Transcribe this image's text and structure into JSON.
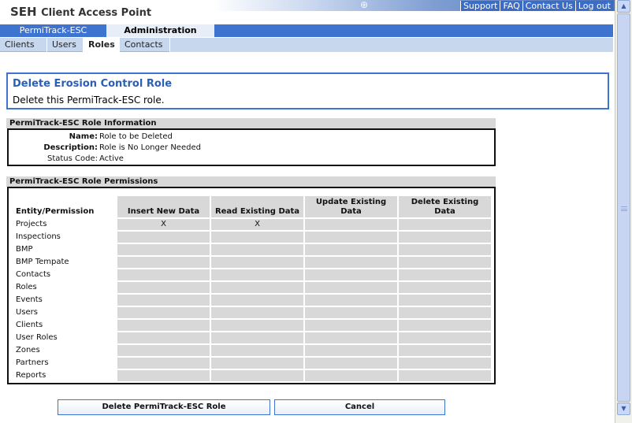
{
  "header": {
    "logo_brand": "SEH",
    "logo_title": "Client Access Point",
    "links": [
      "Support",
      "FAQ",
      "Contact Us",
      "Log out"
    ]
  },
  "main_tabs": [
    "PermiTrack-ESC",
    "Administration"
  ],
  "sub_tabs": [
    "Clients",
    "Users",
    "Roles",
    "Contacts"
  ],
  "page": {
    "title": "Delete Erosion Control Role",
    "subtitle": "Delete this PermiTrack-ESC role."
  },
  "info": {
    "header": "PermiTrack-ESC Role Information",
    "name_label": "Name:",
    "name_value": "Role to be Deleted",
    "description_label": "Description:",
    "description_value": "Role is No Longer Needed",
    "status_label": "Status Code:",
    "status_value": "Active"
  },
  "permissions": {
    "header": "PermiTrack-ESC Role Permissions",
    "columns": [
      "Entity/Permission",
      "Insert New Data",
      "Read Existing Data",
      "Update Existing Data",
      "Delete Existing Data"
    ],
    "rows": [
      {
        "entity": "Projects",
        "insert": "X",
        "read": "X",
        "update": "",
        "delete": ""
      },
      {
        "entity": "Inspections",
        "insert": "",
        "read": "",
        "update": "",
        "delete": ""
      },
      {
        "entity": "BMP",
        "insert": "",
        "read": "",
        "update": "",
        "delete": ""
      },
      {
        "entity": "BMP Tempate",
        "insert": "",
        "read": "",
        "update": "",
        "delete": ""
      },
      {
        "entity": "Contacts",
        "insert": "",
        "read": "",
        "update": "",
        "delete": ""
      },
      {
        "entity": "Roles",
        "insert": "",
        "read": "",
        "update": "",
        "delete": ""
      },
      {
        "entity": "Events",
        "insert": "",
        "read": "",
        "update": "",
        "delete": ""
      },
      {
        "entity": "Users",
        "insert": "",
        "read": "",
        "update": "",
        "delete": ""
      },
      {
        "entity": "Clients",
        "insert": "",
        "read": "",
        "update": "",
        "delete": ""
      },
      {
        "entity": "User Roles",
        "insert": "",
        "read": "",
        "update": "",
        "delete": ""
      },
      {
        "entity": "Zones",
        "insert": "",
        "read": "",
        "update": "",
        "delete": ""
      },
      {
        "entity": "Partners",
        "insert": "",
        "read": "",
        "update": "",
        "delete": ""
      },
      {
        "entity": "Reports",
        "insert": "",
        "read": "",
        "update": "",
        "delete": ""
      }
    ]
  },
  "buttons": {
    "delete_label": "Delete PermiTrack-ESC Role",
    "cancel_label": "Cancel"
  },
  "colors": {
    "accent": "#3f73d0",
    "title_text": "#2a5fb5",
    "cell_gray": "#d8d8d8"
  }
}
